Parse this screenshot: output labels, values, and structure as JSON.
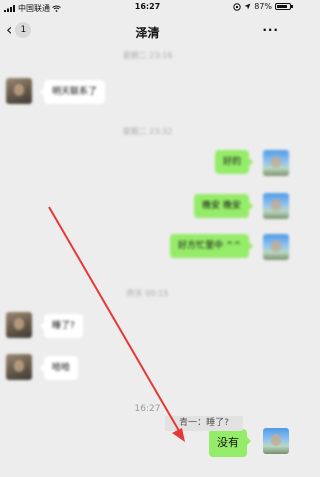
{
  "status_bar": {
    "carrier": "中国联通",
    "time": "16:27",
    "battery": "87%",
    "battery_level": 0.87
  },
  "nav": {
    "back_count": "1",
    "title": "泽清",
    "more": "···"
  },
  "messages": {
    "time_1": "星期二 23:16",
    "m1": "明天联系了",
    "time_2": "星期二 23:32",
    "m2": "好的",
    "m3": "晚安 晚安",
    "m4": "好方忙里中 ^^",
    "time_3": "昨天 00:15",
    "m5": "睡了?",
    "m6": "哈哈",
    "time_4": "16:27",
    "m7": "没有",
    "quote": "青一：睡了?"
  },
  "colors": {
    "background": "#ededed",
    "sent_bubble": "#95ec69",
    "received_bubble": "#ffffff",
    "arrow": "#e53935"
  },
  "icons": {
    "back": "chevron-left-icon",
    "more": "more-dots-icon",
    "signal": "signal-icon",
    "wifi": "wifi-icon",
    "battery": "battery-icon"
  }
}
